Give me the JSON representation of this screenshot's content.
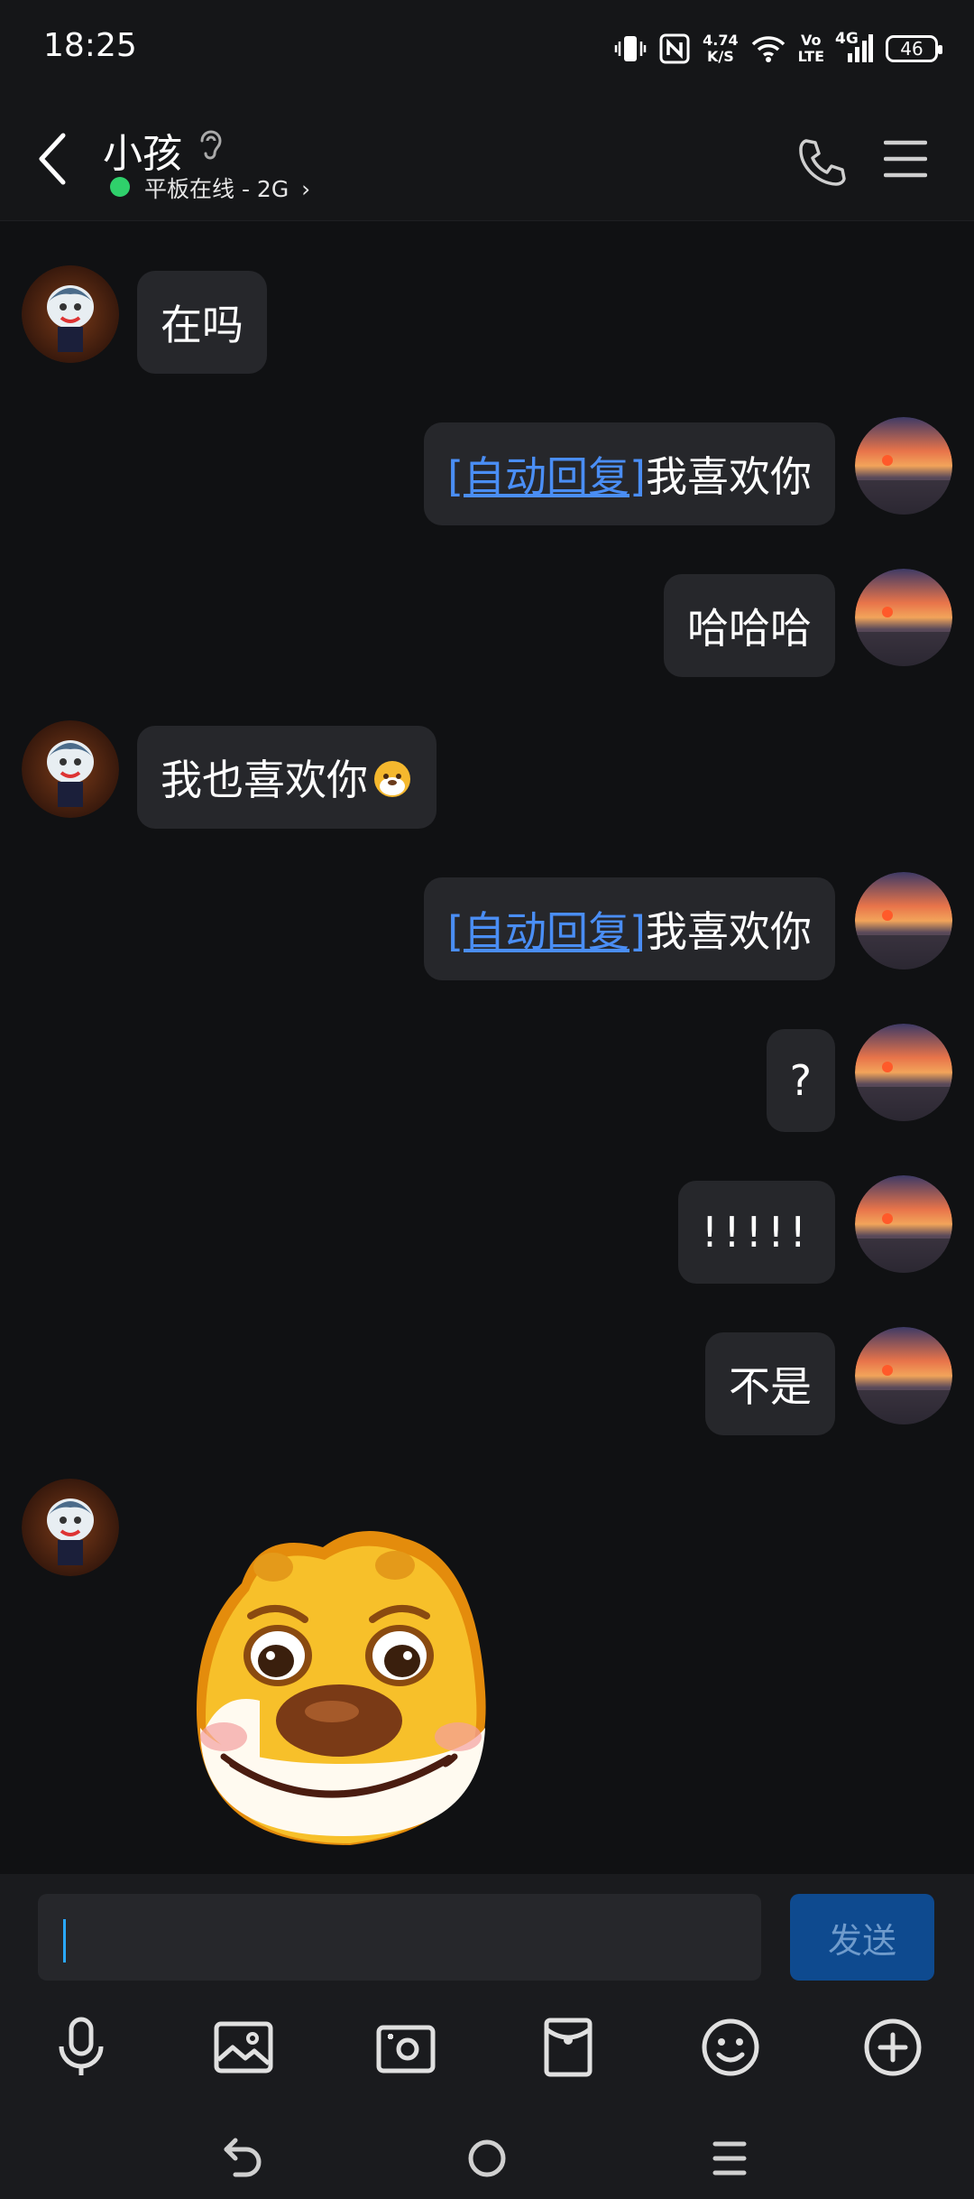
{
  "status_bar": {
    "time": "18:25",
    "net_speed_value": "4.74",
    "net_speed_unit": "K/S",
    "volte_top": "Vo",
    "volte_bottom": "LTE",
    "network_type": "4G",
    "battery": "46"
  },
  "header": {
    "contact_name": "小孩",
    "online_status": "平板在线 - 2G",
    "online_chevron": "›"
  },
  "messages": [
    {
      "side": "left",
      "text": "在吗"
    },
    {
      "side": "right",
      "tag": "[自动回复]",
      "text": "我喜欢你"
    },
    {
      "side": "right",
      "text": "哈哈哈"
    },
    {
      "side": "left",
      "text": "我也喜欢你"
    },
    {
      "side": "right",
      "tag": "[自动回复]",
      "text": "我喜欢你"
    },
    {
      "side": "right",
      "text": "?"
    },
    {
      "side": "right",
      "text": "!!!!!"
    },
    {
      "side": "right",
      "text": "不是"
    },
    {
      "side": "left",
      "type": "sticker"
    }
  ],
  "input": {
    "value": "",
    "send_label": "发送"
  },
  "toolbar_icons": [
    "microphone-icon",
    "image-icon",
    "camera-icon",
    "red-packet-icon",
    "emoji-icon",
    "plus-icon"
  ],
  "nav_icons": [
    "back-gesture-icon",
    "home-icon",
    "recents-icon"
  ],
  "colors": {
    "background": "#101113",
    "bubble": "#26272b",
    "link": "#4a8ef5",
    "online": "#2fd06b",
    "send_button": "#0e4a8f"
  }
}
